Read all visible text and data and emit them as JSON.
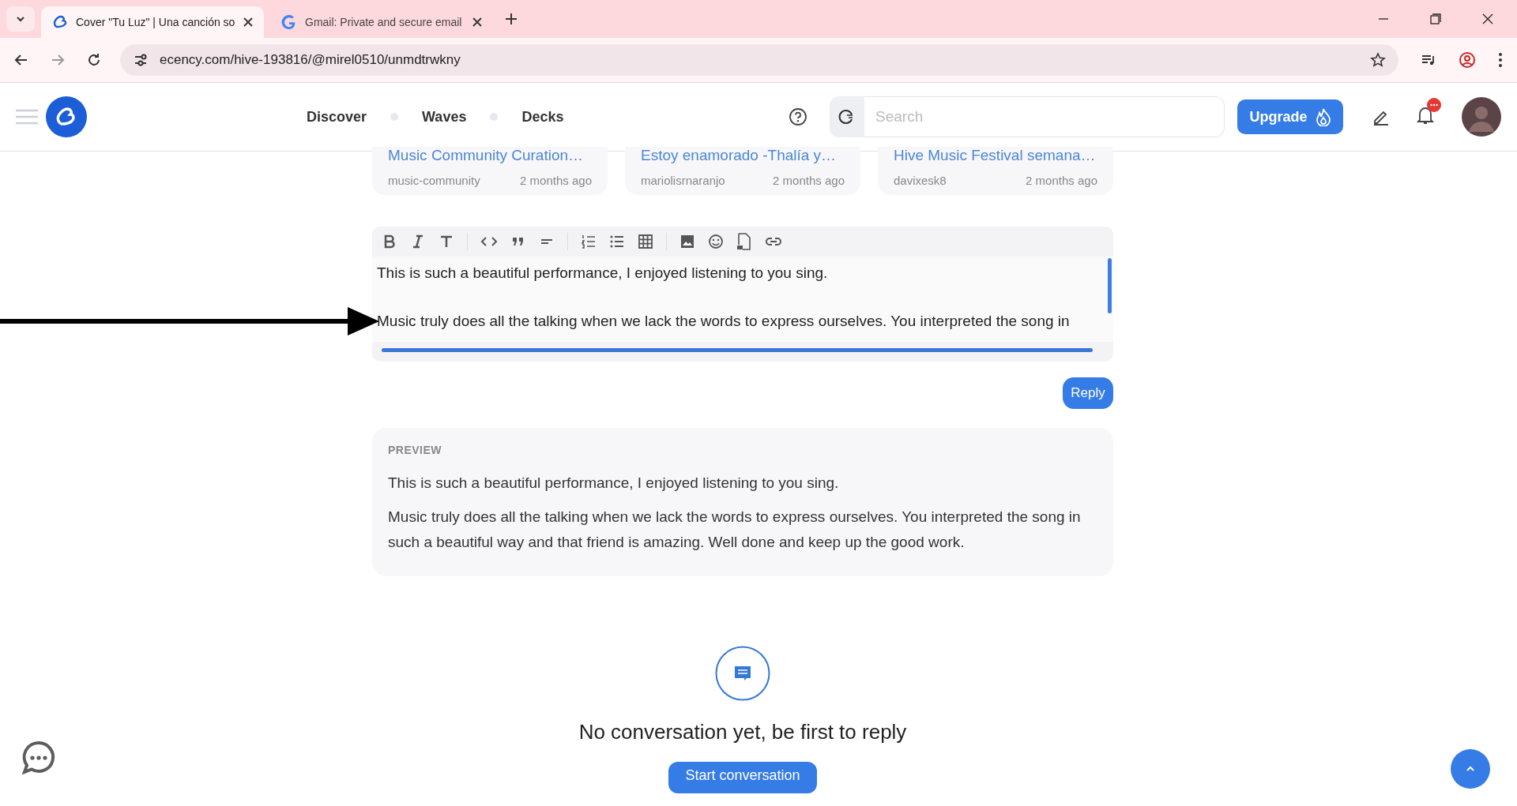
{
  "browser": {
    "tabs": [
      {
        "title": "Cover \"Tu Luz\" | Una canción so",
        "selected": true,
        "kind": "ecency"
      },
      {
        "title": "Gmail: Private and secure email",
        "selected": false,
        "kind": "google"
      }
    ],
    "url": "ecency.com/hive-193816/@mirel0510/unmdtrwkny"
  },
  "header": {
    "nav": [
      "Discover",
      "Waves",
      "Decks"
    ],
    "search": {
      "placeholder": "Search"
    },
    "upgrade": "Upgrade"
  },
  "cards": [
    {
      "title": "Music Community Curation…",
      "author": "music-community",
      "time": "2 months ago"
    },
    {
      "title": "Estoy enamorado -Thalía y…",
      "author": "mariolisrnaranjo",
      "time": "2 months ago"
    },
    {
      "title": "Hive Music Festival semana…",
      "author": "davixesk8",
      "time": "2 months ago"
    }
  ],
  "editor": {
    "toolbar": [
      [
        {
          "kind": "bold"
        },
        {
          "kind": "italic"
        },
        {
          "kind": "heading"
        }
      ],
      [
        {
          "kind": "code"
        },
        {
          "kind": "quote"
        },
        {
          "kind": "rule"
        }
      ],
      [
        {
          "kind": "ordered-list"
        },
        {
          "kind": "bullet-list"
        },
        {
          "kind": "table"
        }
      ],
      [
        {
          "kind": "image"
        },
        {
          "kind": "emoji"
        },
        {
          "kind": "gif"
        },
        {
          "kind": "link"
        }
      ]
    ],
    "lines": [
      "This is such  a beautiful performance, I enjoyed listening to you sing.",
      "Music truly does all the talking when we lack the words to express ourselves. You interpreted the song in"
    ]
  },
  "reply": "Reply",
  "preview": {
    "label": "PREVIEW",
    "paragraphs": [
      "This is such a beautiful performance, I enjoyed listening to you sing.",
      "Music truly does all the talking when we lack the words to express ourselves. You interpreted the song in such a beautiful way and that friend is amazing. Well done and keep up the good work."
    ]
  },
  "empty": {
    "message": "No conversation yet, be first to reply",
    "button": "Start conversation"
  }
}
